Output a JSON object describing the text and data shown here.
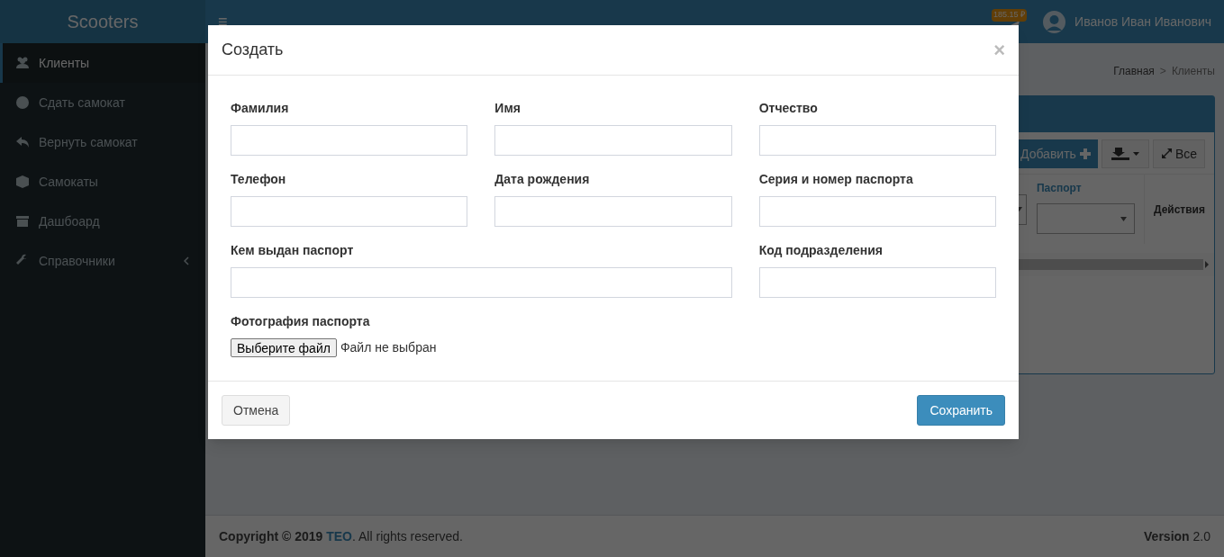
{
  "app": {
    "logo": "Scooters",
    "menu": "≡"
  },
  "sidebar": {
    "items": [
      {
        "label": "Клиенты",
        "kind": "users",
        "selected": true
      },
      {
        "label": "Сдать самокат",
        "kind": "disc",
        "selected": false
      },
      {
        "label": "Вернуть самокат",
        "kind": "reply",
        "selected": false
      },
      {
        "label": "Самокаты",
        "kind": "cube",
        "selected": false
      },
      {
        "label": "Дашбоард",
        "kind": "archive",
        "selected": false
      },
      {
        "label": "Справочники",
        "kind": "wrench",
        "selected": false,
        "expandable": true
      }
    ]
  },
  "topbar": {
    "balance": "185.15 ₽",
    "user": "Иванов Иван Иванович"
  },
  "breadcrumb": {
    "items": [
      "Главная",
      "Клиенты"
    ],
    "separator": ">"
  },
  "card": {
    "add_button": "Добавить",
    "all_button": "Все",
    "columns": [
      {
        "label": "Паспорт",
        "kind": "filter"
      },
      {
        "label": "Действия",
        "kind": "plain"
      }
    ]
  },
  "modal": {
    "title": "Создать",
    "close": "×",
    "fields": [
      {
        "label": "Фамилия",
        "kind": "text"
      },
      {
        "label": "Имя",
        "kind": "text"
      },
      {
        "label": "Отчество",
        "kind": "text"
      },
      {
        "label": "Телефон",
        "kind": "text"
      },
      {
        "label": "Дата рождения",
        "kind": "text"
      },
      {
        "label": "Серия и номер паспорта",
        "kind": "text"
      },
      {
        "label": "Кем выдан паспорт",
        "kind": "wide"
      },
      {
        "label": "Код подразделения",
        "kind": "text"
      },
      {
        "label": "Фотография паспорта",
        "kind": "file",
        "button": "Выберите файл",
        "status": "Файл не выбран"
      }
    ],
    "cancel": "Отмена",
    "save": "Сохранить"
  },
  "footer": {
    "copyright_start": "Copyright © 2019",
    "link": "TEO",
    "copyright_end": ". All rights reserved.",
    "version": "**Version** 2.0"
  }
}
